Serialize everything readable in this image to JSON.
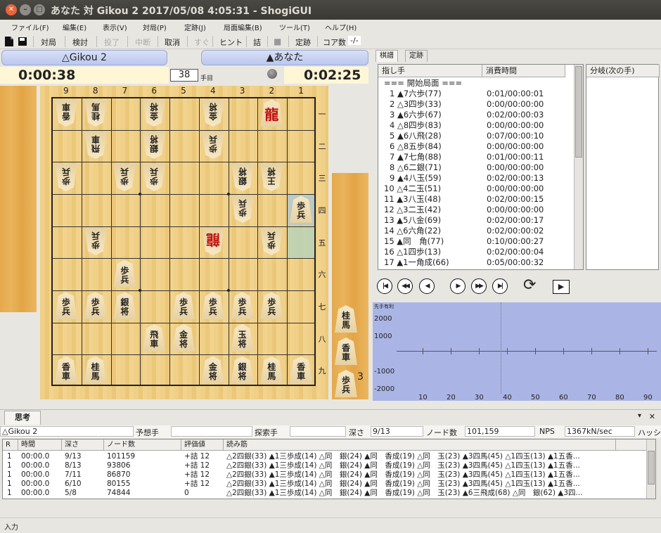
{
  "window": {
    "title": "あなた 対 Gikou 2 2017/05/08 4:05:31 - ShogiGUI"
  },
  "menu": [
    "ファイル(F)",
    "編集(E)",
    "表示(V)",
    "対局(P)",
    "定跡(J)",
    "局面編集(B)",
    "ツール(T)",
    "ヘルプ(H)"
  ],
  "toolbar": {
    "taikyoku": "対局",
    "kento": "検討",
    "toryo": "投了",
    "chudan": "中断",
    "torikeshi": "取消",
    "sugu": "すぐ",
    "hint": "ヒント",
    "tsume": "詰",
    "joseki": "定跡",
    "cores_label": "コア数",
    "cores_value": "-/-"
  },
  "players": {
    "gote": {
      "name": "△Gikou 2",
      "clock": "0:00:38"
    },
    "sente": {
      "name": "▲あなた",
      "clock": "0:02:25"
    }
  },
  "move_number": "38",
  "move_suffix": "手目",
  "board": {
    "files": [
      "9",
      "8",
      "7",
      "6",
      "5",
      "4",
      "3",
      "2",
      "1"
    ],
    "ranks": [
      "一",
      "二",
      "三",
      "四",
      "五",
      "六",
      "七",
      "八",
      "九"
    ],
    "pieces": [
      {
        "c": 0,
        "r": 0,
        "t": "香車",
        "gote": true
      },
      {
        "c": 1,
        "r": 0,
        "t": "桂馬",
        "gote": true
      },
      {
        "c": 3,
        "r": 0,
        "t": "金将",
        "gote": true
      },
      {
        "c": 5,
        "r": 0,
        "t": "金将",
        "gote": true
      },
      {
        "c": 7,
        "r": 0,
        "t": "龍",
        "gote": false,
        "red": true
      },
      {
        "c": 1,
        "r": 1,
        "t": "飛車",
        "gote": true
      },
      {
        "c": 3,
        "r": 1,
        "t": "銀将",
        "gote": true
      },
      {
        "c": 5,
        "r": 1,
        "t": "歩兵",
        "gote": true
      },
      {
        "c": 0,
        "r": 2,
        "t": "歩兵",
        "gote": true
      },
      {
        "c": 2,
        "r": 2,
        "t": "歩兵",
        "gote": true
      },
      {
        "c": 3,
        "r": 2,
        "t": "歩兵",
        "gote": true
      },
      {
        "c": 6,
        "r": 2,
        "t": "銀将",
        "gote": true
      },
      {
        "c": 7,
        "r": 2,
        "t": "王将",
        "gote": true
      },
      {
        "c": 6,
        "r": 3,
        "t": "歩兵",
        "gote": true
      },
      {
        "c": 8,
        "r": 3,
        "t": "歩兵",
        "gote": false
      },
      {
        "c": 1,
        "r": 4,
        "t": "歩兵",
        "gote": true
      },
      {
        "c": 5,
        "r": 4,
        "t": "龍",
        "gote": true,
        "red": true
      },
      {
        "c": 7,
        "r": 4,
        "t": "歩兵",
        "gote": true
      },
      {
        "c": 2,
        "r": 5,
        "t": "歩兵",
        "gote": false
      },
      {
        "c": 0,
        "r": 6,
        "t": "歩兵",
        "gote": false
      },
      {
        "c": 1,
        "r": 6,
        "t": "歩兵",
        "gote": false
      },
      {
        "c": 2,
        "r": 6,
        "t": "銀将",
        "gote": false
      },
      {
        "c": 4,
        "r": 6,
        "t": "歩兵",
        "gote": false
      },
      {
        "c": 5,
        "r": 6,
        "t": "歩兵",
        "gote": false
      },
      {
        "c": 6,
        "r": 6,
        "t": "歩兵",
        "gote": false
      },
      {
        "c": 7,
        "r": 6,
        "t": "歩兵",
        "gote": false
      },
      {
        "c": 3,
        "r": 7,
        "t": "飛車",
        "gote": false
      },
      {
        "c": 4,
        "r": 7,
        "t": "金将",
        "gote": false
      },
      {
        "c": 6,
        "r": 7,
        "t": "玉将",
        "gote": false
      },
      {
        "c": 0,
        "r": 8,
        "t": "香車",
        "gote": false
      },
      {
        "c": 1,
        "r": 8,
        "t": "桂馬",
        "gote": false
      },
      {
        "c": 5,
        "r": 8,
        "t": "金将",
        "gote": false
      },
      {
        "c": 6,
        "r": 8,
        "t": "銀将",
        "gote": false
      },
      {
        "c": 7,
        "r": 8,
        "t": "桂馬",
        "gote": false
      },
      {
        "c": 8,
        "r": 8,
        "t": "香車",
        "gote": false
      }
    ],
    "highlight_from": {
      "c": 8,
      "r": 4
    },
    "highlight_to": {
      "c": 8,
      "r": 3
    }
  },
  "sente_hand": [
    {
      "t": "桂馬"
    },
    {
      "t": "香車"
    },
    {
      "t": "歩兵",
      "count": "3"
    }
  ],
  "tabs": [
    "棋譜",
    "定跡"
  ],
  "kifu": {
    "col_move": "指し手",
    "col_time": "消費時間",
    "rows": [
      {
        "m": "=== 開始局面 ===",
        "t": ""
      },
      {
        "m": "1 ▲7六歩(77)",
        "t": "0:01/00:00:01"
      },
      {
        "m": "2 △3四歩(33)",
        "t": "0:00/00:00:00"
      },
      {
        "m": "3 ▲6六歩(67)",
        "t": "0:02/00:00:03"
      },
      {
        "m": "4 △8四歩(83)",
        "t": "0:00/00:00:00"
      },
      {
        "m": "5 ▲6八飛(28)",
        "t": "0:07/00:00:10"
      },
      {
        "m": "6 △8五歩(84)",
        "t": "0:00/00:00:00"
      },
      {
        "m": "7 ▲7七角(88)",
        "t": "0:01/00:00:11"
      },
      {
        "m": "8 △6二銀(71)",
        "t": "0:00/00:00:00"
      },
      {
        "m": "9 ▲4八玉(59)",
        "t": "0:02/00:00:13"
      },
      {
        "m": "10 △4二玉(51)",
        "t": "0:00/00:00:00"
      },
      {
        "m": "11 ▲3八玉(48)",
        "t": "0:02/00:00:15"
      },
      {
        "m": "12 △3二玉(42)",
        "t": "0:00/00:00:00"
      },
      {
        "m": "13 ▲5八金(69)",
        "t": "0:02/00:00:17"
      },
      {
        "m": "14 △6六角(22)",
        "t": "0:02/00:00:02"
      },
      {
        "m": "15 ▲同　角(77)",
        "t": "0:10/00:00:27"
      },
      {
        "m": "16 △1四歩(13)",
        "t": "0:02/00:00:04"
      },
      {
        "m": "17 ▲1一角成(66)",
        "t": "0:05/00:00:32"
      }
    ]
  },
  "branch": {
    "header": "分岐(次の手)"
  },
  "eval": {
    "label": "先手有利",
    "y_ticks": [
      "2000",
      "1000",
      "-1000",
      "-2000"
    ],
    "x_ticks": [
      "10",
      "20",
      "30",
      "40",
      "50",
      "60",
      "70",
      "80",
      "90"
    ]
  },
  "thinking": {
    "tab": "思考",
    "engine": "△Gikou 2",
    "yosouteshu_label": "予想手",
    "tansakute_label": "探索手",
    "depth_label": "深さ",
    "depth_value": "9/13",
    "nodes_label": "ノード数",
    "nodes_value": "101,159",
    "nps_label": "NPS",
    "nps_value": "1367kN/sec",
    "hash_label": "ハッシ",
    "headers": [
      "R",
      "時間",
      "深さ",
      "ノード数",
      "評価値",
      "読み筋"
    ],
    "rows": [
      {
        "r": "1",
        "time": "00:00.0",
        "depth": "9/13",
        "nodes": "101159",
        "score": "+詰 12",
        "pv": "△2四銀(33) ▲1三歩成(14) △同　銀(24) ▲同　香成(19) △同　玉(23) ▲3四馬(45) △1四玉(13) ▲1五香..."
      },
      {
        "r": "1",
        "time": "00:00.0",
        "depth": "8/13",
        "nodes": "93806",
        "score": "+詰 12",
        "pv": "△2四銀(33) ▲1三歩成(14) △同　銀(24) ▲同　香成(19) △同　玉(23) ▲3四馬(45) △1四玉(13) ▲1五香..."
      },
      {
        "r": "1",
        "time": "00:00.0",
        "depth": "7/11",
        "nodes": "86870",
        "score": "+詰 12",
        "pv": "△2四銀(33) ▲1三歩成(14) △同　銀(24) ▲同　香成(19) △同　玉(23) ▲3四馬(45) △1四玉(13) ▲1五香..."
      },
      {
        "r": "1",
        "time": "00:00.0",
        "depth": "6/10",
        "nodes": "80155",
        "score": "+詰 12",
        "pv": "△2四銀(33) ▲1三歩成(14) △同　銀(24) ▲同　香成(19) △同　玉(23) ▲3四馬(45) △1四玉(13) ▲1五香..."
      },
      {
        "r": "1",
        "time": "00:00.0",
        "depth": "5/8",
        "nodes": "74844",
        "score": "0",
        "pv": "△2四銀(33) ▲1三歩成(14) △同　銀(24) ▲同　香成(19) △同　玉(23) ▲6三飛成(68) △同　銀(62) ▲3四..."
      }
    ]
  },
  "status": {
    "input_label": "入力"
  }
}
